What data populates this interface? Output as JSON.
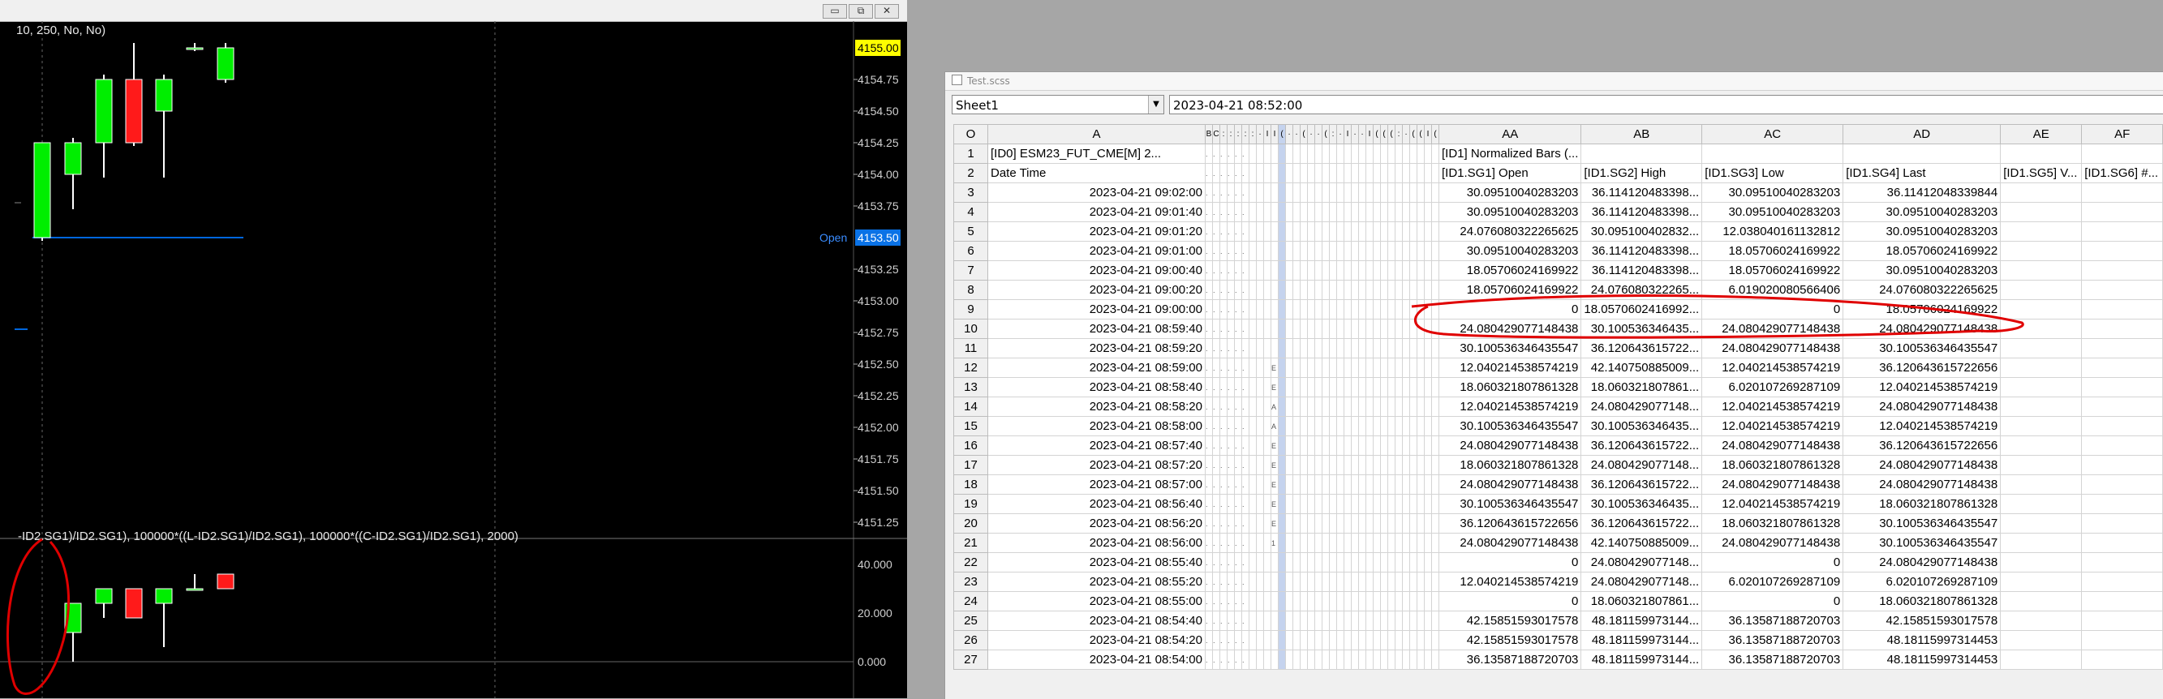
{
  "chart_window": {
    "study_text_top": "10, 250, No, No)",
    "study_text_bottom": "-ID2.SG1)/ID2.SG1), 100000*((L-ID2.SG1)/ID2.SG1), 100000*((C-ID2.SG1)/ID2.SG1), 2000)",
    "open_label": "Open",
    "open_value": "4153.50",
    "last_price": "4155.00",
    "price_axis": [
      "4154.75",
      "4154.50",
      "4154.25",
      "4154.00",
      "4153.75",
      "4153.25",
      "4153.00",
      "4152.75",
      "4152.50",
      "4152.25",
      "4152.00",
      "4151.75",
      "4151.50",
      "4151.25"
    ],
    "lower_axis": [
      "40.000",
      "20.000",
      "0.000"
    ],
    "colors": {
      "up": "#00ee00",
      "down": "#ff1a1a",
      "open_line": "#0066dd",
      "last_bg": "#ffff00",
      "open_bg": "#0a72e6",
      "annotation": "#e00000"
    },
    "window_buttons": [
      "minimize-icon",
      "restore-icon",
      "close-icon"
    ]
  },
  "sheet_window": {
    "title": "Test.scss",
    "sheet_selector": "Sheet1",
    "formula_value": "2023-04-21  08:52:00",
    "col_headers": {
      "corner": "O",
      "a": "A",
      "narrow": [
        "B",
        "C",
        ":",
        ":",
        ":",
        ":",
        ":",
        "·",
        "I",
        "I",
        "(",
        "·",
        "·",
        "(",
        "·",
        "·",
        "(",
        ":",
        "·",
        "I",
        "·",
        "·",
        "I",
        "(",
        "(",
        "(",
        ":",
        "·",
        "(",
        "(",
        "I",
        "("
      ],
      "aa": "AA",
      "ab": "AB",
      "ac": "AC",
      "ad": "AD",
      "ae": "AE",
      "af": "AF"
    },
    "row1": {
      "a": "[ID0] ESM23_FUT_CME[M]  2...",
      "aa": "[ID1] Normalized Bars (..."
    },
    "row2": {
      "a": "Date Time",
      "aa": "[ID1.SG1] Open",
      "ab": "[ID1.SG2] High",
      "ac": "[ID1.SG3] Low",
      "ad": "[ID1.SG4] Last",
      "ae": "[ID1.SG5] V...",
      "af": "[ID1.SG6] #..."
    },
    "rows": [
      {
        "n": "3",
        "dt": "2023-04-21  09:02:00",
        "aa": "30.09510040283203",
        "ab": "36.114120483398...",
        "ac": "30.09510040283203",
        "ad": "36.11412048339844"
      },
      {
        "n": "4",
        "dt": "2023-04-21  09:01:40",
        "aa": "30.09510040283203",
        "ab": "36.114120483398...",
        "ac": "30.09510040283203",
        "ad": "30.09510040283203"
      },
      {
        "n": "5",
        "dt": "2023-04-21  09:01:20",
        "aa": "24.076080322265625",
        "ab": "30.095100402832...",
        "ac": "12.038040161132812",
        "ad": "30.09510040283203"
      },
      {
        "n": "6",
        "dt": "2023-04-21  09:01:00",
        "aa": "30.09510040283203",
        "ab": "36.114120483398...",
        "ac": "18.05706024169922",
        "ad": "18.05706024169922"
      },
      {
        "n": "7",
        "dt": "2023-04-21  09:00:40",
        "aa": "18.05706024169922",
        "ab": "36.114120483398...",
        "ac": "18.05706024169922",
        "ad": "30.09510040283203"
      },
      {
        "n": "8",
        "dt": "2023-04-21  09:00:20",
        "aa": "18.05706024169922",
        "ab": "24.076080322265...",
        "ac": "6.019020080566406",
        "ad": "24.076080322265625"
      },
      {
        "n": "9",
        "dt": "2023-04-21  09:00:00",
        "aa": "0",
        "ab": "18.0570602416992...",
        "ac": "0",
        "ad": "18.05706024169922"
      },
      {
        "n": "10",
        "dt": "2023-04-21  08:59:40",
        "aa": "24.080429077148438",
        "ab": "30.100536346435...",
        "ac": "24.080429077148438",
        "ad": "24.080429077148438"
      },
      {
        "n": "11",
        "dt": "2023-04-21  08:59:20",
        "aa": "30.100536346435547",
        "ab": "36.120643615722...",
        "ac": "24.080429077148438",
        "ad": "30.100536346435547"
      },
      {
        "n": "12",
        "dt": "2023-04-21  08:59:00",
        "aa": "12.040214538574219",
        "ab": "42.140750885009...",
        "ac": "12.040214538574219",
        "ad": "36.120643615722656"
      },
      {
        "n": "13",
        "dt": "2023-04-21  08:58:40",
        "aa": "18.060321807861328",
        "ab": "18.060321807861...",
        "ac": "6.020107269287109",
        "ad": "12.040214538574219"
      },
      {
        "n": "14",
        "dt": "2023-04-21  08:58:20",
        "aa": "12.040214538574219",
        "ab": "24.080429077148...",
        "ac": "12.040214538574219",
        "ad": "24.080429077148438"
      },
      {
        "n": "15",
        "dt": "2023-04-21  08:58:00",
        "aa": "30.100536346435547",
        "ab": "30.100536346435...",
        "ac": "12.040214538574219",
        "ad": "12.040214538574219"
      },
      {
        "n": "16",
        "dt": "2023-04-21  08:57:40",
        "aa": "24.080429077148438",
        "ab": "36.120643615722...",
        "ac": "24.080429077148438",
        "ad": "36.120643615722656"
      },
      {
        "n": "17",
        "dt": "2023-04-21  08:57:20",
        "aa": "18.060321807861328",
        "ab": "24.080429077148...",
        "ac": "18.060321807861328",
        "ad": "24.080429077148438"
      },
      {
        "n": "18",
        "dt": "2023-04-21  08:57:00",
        "aa": "24.080429077148438",
        "ab": "36.120643615722...",
        "ac": "24.080429077148438",
        "ad": "24.080429077148438"
      },
      {
        "n": "19",
        "dt": "2023-04-21  08:56:40",
        "aa": "30.100536346435547",
        "ab": "30.100536346435...",
        "ac": "12.040214538574219",
        "ad": "18.060321807861328"
      },
      {
        "n": "20",
        "dt": "2023-04-21  08:56:20",
        "aa": "36.120643615722656",
        "ab": "36.120643615722...",
        "ac": "18.060321807861328",
        "ad": "30.100536346435547"
      },
      {
        "n": "21",
        "dt": "2023-04-21  08:56:00",
        "aa": "24.080429077148438",
        "ab": "42.140750885009...",
        "ac": "24.080429077148438",
        "ad": "30.100536346435547"
      },
      {
        "n": "22",
        "dt": "2023-04-21  08:55:40",
        "aa": "0",
        "ab": "24.080429077148...",
        "ac": "0",
        "ad": "24.080429077148438"
      },
      {
        "n": "23",
        "dt": "2023-04-21  08:55:20",
        "aa": "12.040214538574219",
        "ab": "24.080429077148...",
        "ac": "6.020107269287109",
        "ad": "6.020107269287109"
      },
      {
        "n": "24",
        "dt": "2023-04-21  08:55:00",
        "aa": "0",
        "ab": "18.060321807861...",
        "ac": "0",
        "ad": "18.060321807861328"
      },
      {
        "n": "25",
        "dt": "2023-04-21  08:54:40",
        "aa": "42.15851593017578",
        "ab": "48.181159973144...",
        "ac": "36.13587188720703",
        "ad": "42.15851593017578"
      },
      {
        "n": "26",
        "dt": "2023-04-21  08:54:20",
        "aa": "42.15851593017578",
        "ab": "48.181159973144...",
        "ac": "36.13587188720703",
        "ad": "48.18115997314453"
      },
      {
        "n": "27",
        "dt": "2023-04-21  08:54:00",
        "aa": "36.13587188720703",
        "ab": "48.181159973144...",
        "ac": "36.13587188720703",
        "ad": "48.18115997314453"
      }
    ],
    "narrow_marks": {
      "12": "E",
      "13": "E",
      "14": "A",
      "15": "A",
      "16": "E",
      "17": "E",
      "18": "E",
      "19": "E",
      "20": "E",
      "21": "1"
    }
  }
}
